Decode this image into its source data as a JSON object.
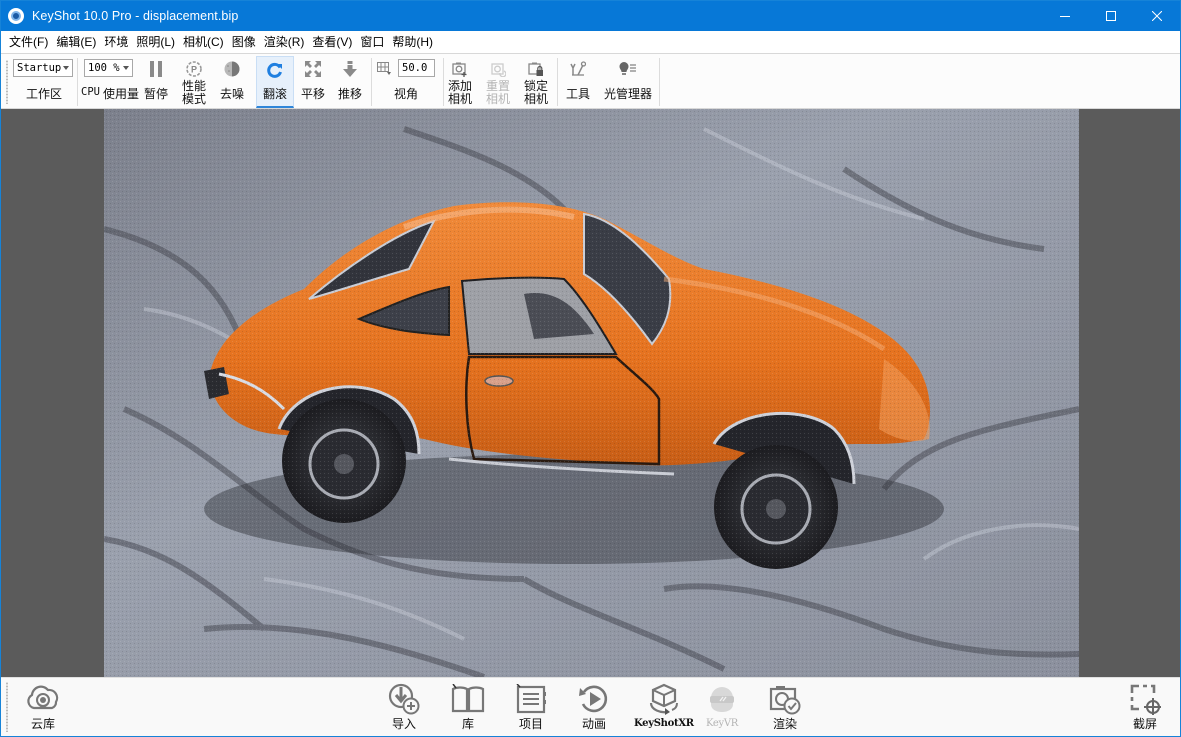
{
  "window": {
    "title": "KeyShot 10.0 Pro  - displacement.bip",
    "controls": {
      "minimize": "minimize",
      "maximize": "maximize",
      "close": "close"
    }
  },
  "menu": [
    "文件(F)",
    "编辑(E)",
    "环境",
    "照明(L)",
    "相机(C)",
    "图像",
    "渲染(R)",
    "查看(V)",
    "窗口",
    "帮助(H)"
  ],
  "toolbar": {
    "workspace": {
      "value": "Startup",
      "label": "工作区"
    },
    "cpu": {
      "value": "100 %",
      "label_prefix": "CPU",
      "label": "使用量"
    },
    "pause": {
      "label": "暂停",
      "icon": "pause-icon"
    },
    "performance": {
      "label_line1": "性能",
      "label_line2": "模式",
      "icon": "performance-mode-icon"
    },
    "denoise": {
      "label": "去噪",
      "icon": "denoise-icon"
    },
    "tumble": {
      "label": "翻滚",
      "icon": "tumble-icon",
      "active": true
    },
    "pan": {
      "label": "平移",
      "icon": "pan-icon"
    },
    "dolly": {
      "label": "推移",
      "icon": "dolly-icon"
    },
    "fov": {
      "value": "50.0",
      "label": "视角",
      "icon": "perspective-grid-icon"
    },
    "add_camera": {
      "label_line1": "添加",
      "label_line2": "相机",
      "icon": "add-camera-icon"
    },
    "reset_camera": {
      "label_line1": "重置",
      "label_line2": "相机",
      "icon": "reset-camera-icon",
      "disabled": true
    },
    "lock_camera": {
      "label_line1": "锁定",
      "label_line2": "相机",
      "icon": "lock-camera-icon"
    },
    "tools": {
      "label": "工具",
      "icon": "tools-icon"
    },
    "light_manager": {
      "label": "光管理器",
      "icon": "light-manager-icon"
    }
  },
  "viewport": {
    "scene": "orange toy sports car on cracked grey stone ground (real-time render)",
    "colors": {
      "background": "#5b5b5b",
      "car_body": "#e8782a",
      "ground": "#8f95a3"
    }
  },
  "bottom_ribbon": {
    "cloud_library": {
      "label": "云库",
      "icon": "cloud-library-icon"
    },
    "items": [
      {
        "label": "导入",
        "icon": "import-icon"
      },
      {
        "label": "库",
        "icon": "library-book-icon"
      },
      {
        "label": "项目",
        "icon": "project-list-icon"
      },
      {
        "label": "动画",
        "icon": "animation-play-icon"
      },
      {
        "label": "KeyShotXR",
        "icon": "keyshotxr-cube-icon"
      },
      {
        "label": "KeyVR",
        "icon": "vr-headset-icon",
        "disabled": true
      },
      {
        "label": "渲染",
        "icon": "render-camera-icon"
      }
    ],
    "screenshot": {
      "label": "截屏",
      "icon": "screenshot-icon"
    }
  },
  "colors": {
    "titlebar": "#0778d7",
    "accent": "#2f86d9",
    "disabled_text": "#b4b4b4"
  }
}
